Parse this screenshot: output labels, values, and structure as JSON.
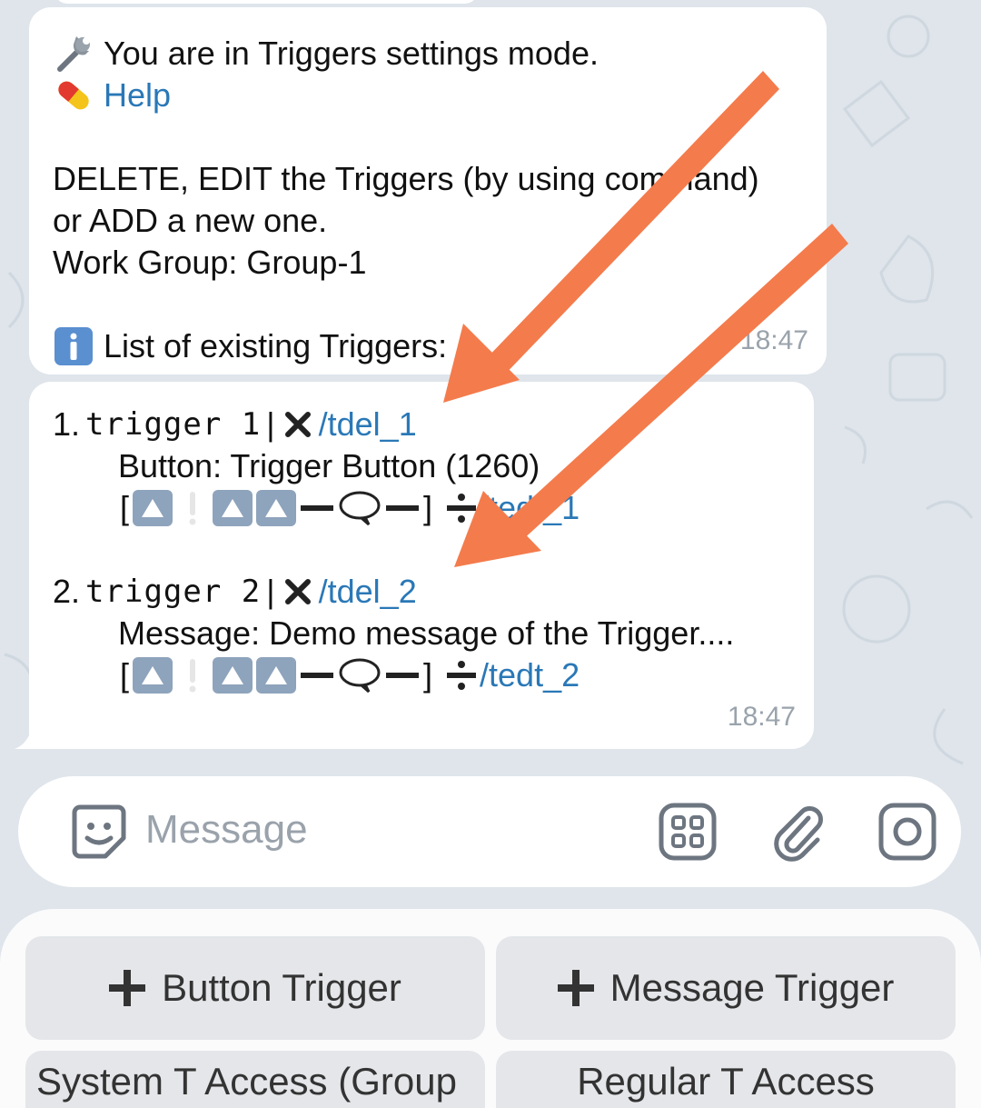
{
  "chat": {
    "message1": {
      "line1": "You are in Triggers settings mode.",
      "help_link": "Help",
      "line3": "DELETE, EDIT the Triggers (by using command)",
      "line4": "or ADD a new one.",
      "line5": "Work Group: Group-1",
      "line6": "List of existing Triggers:",
      "time": "18:47"
    },
    "message2": {
      "triggers": [
        {
          "number": "1.",
          "name": "trigger 1",
          "delete_cmd": "/tdel_1",
          "detail": "Button: Trigger Button (1260)",
          "edit_cmd": "/tedt_1"
        },
        {
          "number": "2.",
          "name": "trigger 2",
          "delete_cmd": "/tdel_2",
          "detail": "Message: Demo message of the Trigger....",
          "edit_cmd": "/tedt_2"
        }
      ],
      "separator": "|",
      "bracket_open": "[",
      "bracket_close": "]",
      "time": "18:47"
    }
  },
  "composer": {
    "placeholder": "Message"
  },
  "keyboard": {
    "buttons": [
      "Button Trigger",
      "Message Trigger",
      "System T Access (Group",
      "Regular T Access"
    ]
  },
  "colors": {
    "link": "#2a78b7",
    "annotation_arrow": "#f47b4c"
  },
  "icons": [
    "wrench-icon",
    "pill-icon",
    "info-icon",
    "sticker-icon",
    "apps-icon",
    "paperclip-icon",
    "camera-icon",
    "plus-icon"
  ]
}
